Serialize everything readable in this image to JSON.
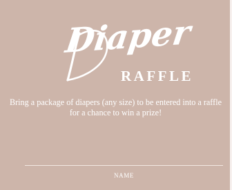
{
  "card": {
    "script_title": "Diaper",
    "subtitle": "RAFFLE",
    "description": "Bring a package of diapers (any size) to be entered into a raffle for a chance to win a prize!",
    "name_label": "NAME"
  },
  "colors": {
    "card_background": "#cdb5aa",
    "page_background": "#f7f1ef",
    "text": "#ffffff",
    "line": "#f2e7e2"
  }
}
